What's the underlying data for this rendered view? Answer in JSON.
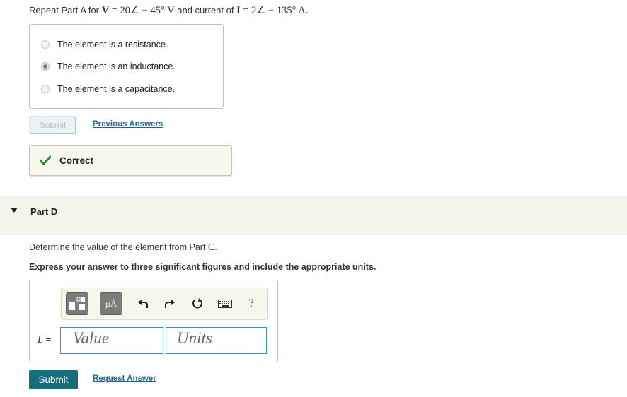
{
  "part_c": {
    "prompt": {
      "intro": "Repeat Part A for",
      "v_sym": "V",
      "v_expr": " = 20∠ − 45° V",
      "middle": " and current of",
      "i_sym": "I",
      "i_expr": " = 2∠ − 135° A."
    },
    "options": [
      {
        "label": "The element is a resistance.",
        "selected": false
      },
      {
        "label": "The element is an inductance.",
        "selected": true
      },
      {
        "label": "The element is a capacitance.",
        "selected": false
      }
    ],
    "submit_label": "Submit",
    "previous_answers_label": "Previous Answers",
    "feedback": {
      "icon": "checkmark-icon",
      "text": "Correct",
      "color": "#1f8a2e"
    }
  },
  "part_d": {
    "title": "Part D",
    "question_prefix": "Determine the value of the element from Part ",
    "question_ref": "C",
    "question_suffix": ".",
    "instruction": "Express your answer to three significant figures and include the appropriate units.",
    "toolbar": {
      "templates_icon": "templates-icon",
      "units_label": "μÅ",
      "undo_icon": "undo-icon",
      "redo_icon": "redo-icon",
      "reset_icon": "reset-icon",
      "keyboard_icon": "keyboard-icon",
      "help_label": "?"
    },
    "variable_label": "L",
    "variable_eq": " =",
    "value_placeholder": "Value",
    "units_placeholder": "Units",
    "submit_label": "Submit",
    "request_answer_label": "Request Answer"
  },
  "colors": {
    "accent": "#176e7c",
    "link": "#1f6a8d",
    "part_bar": "#f3f5ea",
    "field_border": "#3f8fb0"
  }
}
